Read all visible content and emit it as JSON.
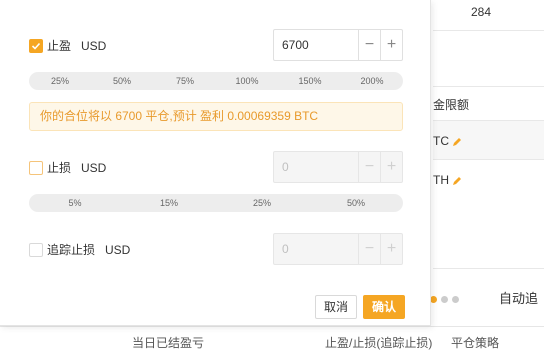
{
  "background": {
    "top_count": "284",
    "limit_label": "金限额",
    "row_btc": "TC",
    "row_eth": "TH",
    "auto_label": "自动追",
    "bottom": {
      "realized_pnl": "当日已结盈亏",
      "tp_sl_trailing": "止盈/止损(追踪止损)",
      "close_strategy": "平仓策略"
    }
  },
  "modal": {
    "take_profit": {
      "label": "止盈",
      "currency": "USD",
      "checked": true,
      "value": "6700",
      "percents": [
        "25%",
        "50%",
        "75%",
        "100%",
        "150%",
        "200%"
      ]
    },
    "info": "你的合位将以 6700 平仓,预计 盈利 0.00069359 BTC",
    "stop_loss": {
      "label": "止损",
      "currency": "USD",
      "checked": false,
      "value": "0",
      "percents": [
        "5%",
        "15%",
        "25%",
        "50%"
      ]
    },
    "trailing_stop": {
      "label": "追踪止损",
      "currency": "USD",
      "checked": false,
      "value": "0"
    },
    "stepper_minus": "−",
    "stepper_plus": "+",
    "cancel": "取消",
    "confirm": "确认"
  },
  "colors": {
    "accent": "#f5a623",
    "info_text": "#e89a2c",
    "info_bg": "#fef7e8"
  }
}
